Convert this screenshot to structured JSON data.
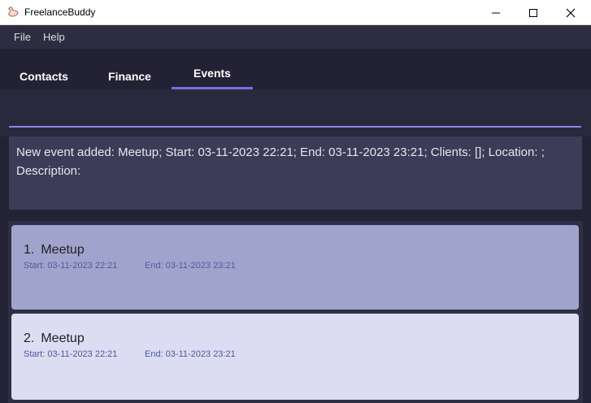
{
  "window": {
    "title": "FreelanceBuddy"
  },
  "menu": {
    "file": "File",
    "help": "Help"
  },
  "tabs": [
    {
      "label": "Contacts",
      "active": false
    },
    {
      "label": "Finance",
      "active": false
    },
    {
      "label": "Events",
      "active": true
    }
  ],
  "command": {
    "value": ""
  },
  "result": {
    "text": "New event added: Meetup; Start: 03-11-2023 22:21; End: 03-11-2023 23:21; Clients: []; Location: ; Description:"
  },
  "events": [
    {
      "index": "1.",
      "name": "Meetup",
      "start": "Start: 03-11-2023 22:21",
      "end": "End: 03-11-2023 23:21"
    },
    {
      "index": "2.",
      "name": "Meetup",
      "start": "Start: 03-11-2023 22:21",
      "end": "End: 03-11-2023 23:21"
    }
  ],
  "colors": {
    "accent": "#7c6ee0",
    "card_selected": "#a0a3cc",
    "card": "#dcdcf3"
  }
}
